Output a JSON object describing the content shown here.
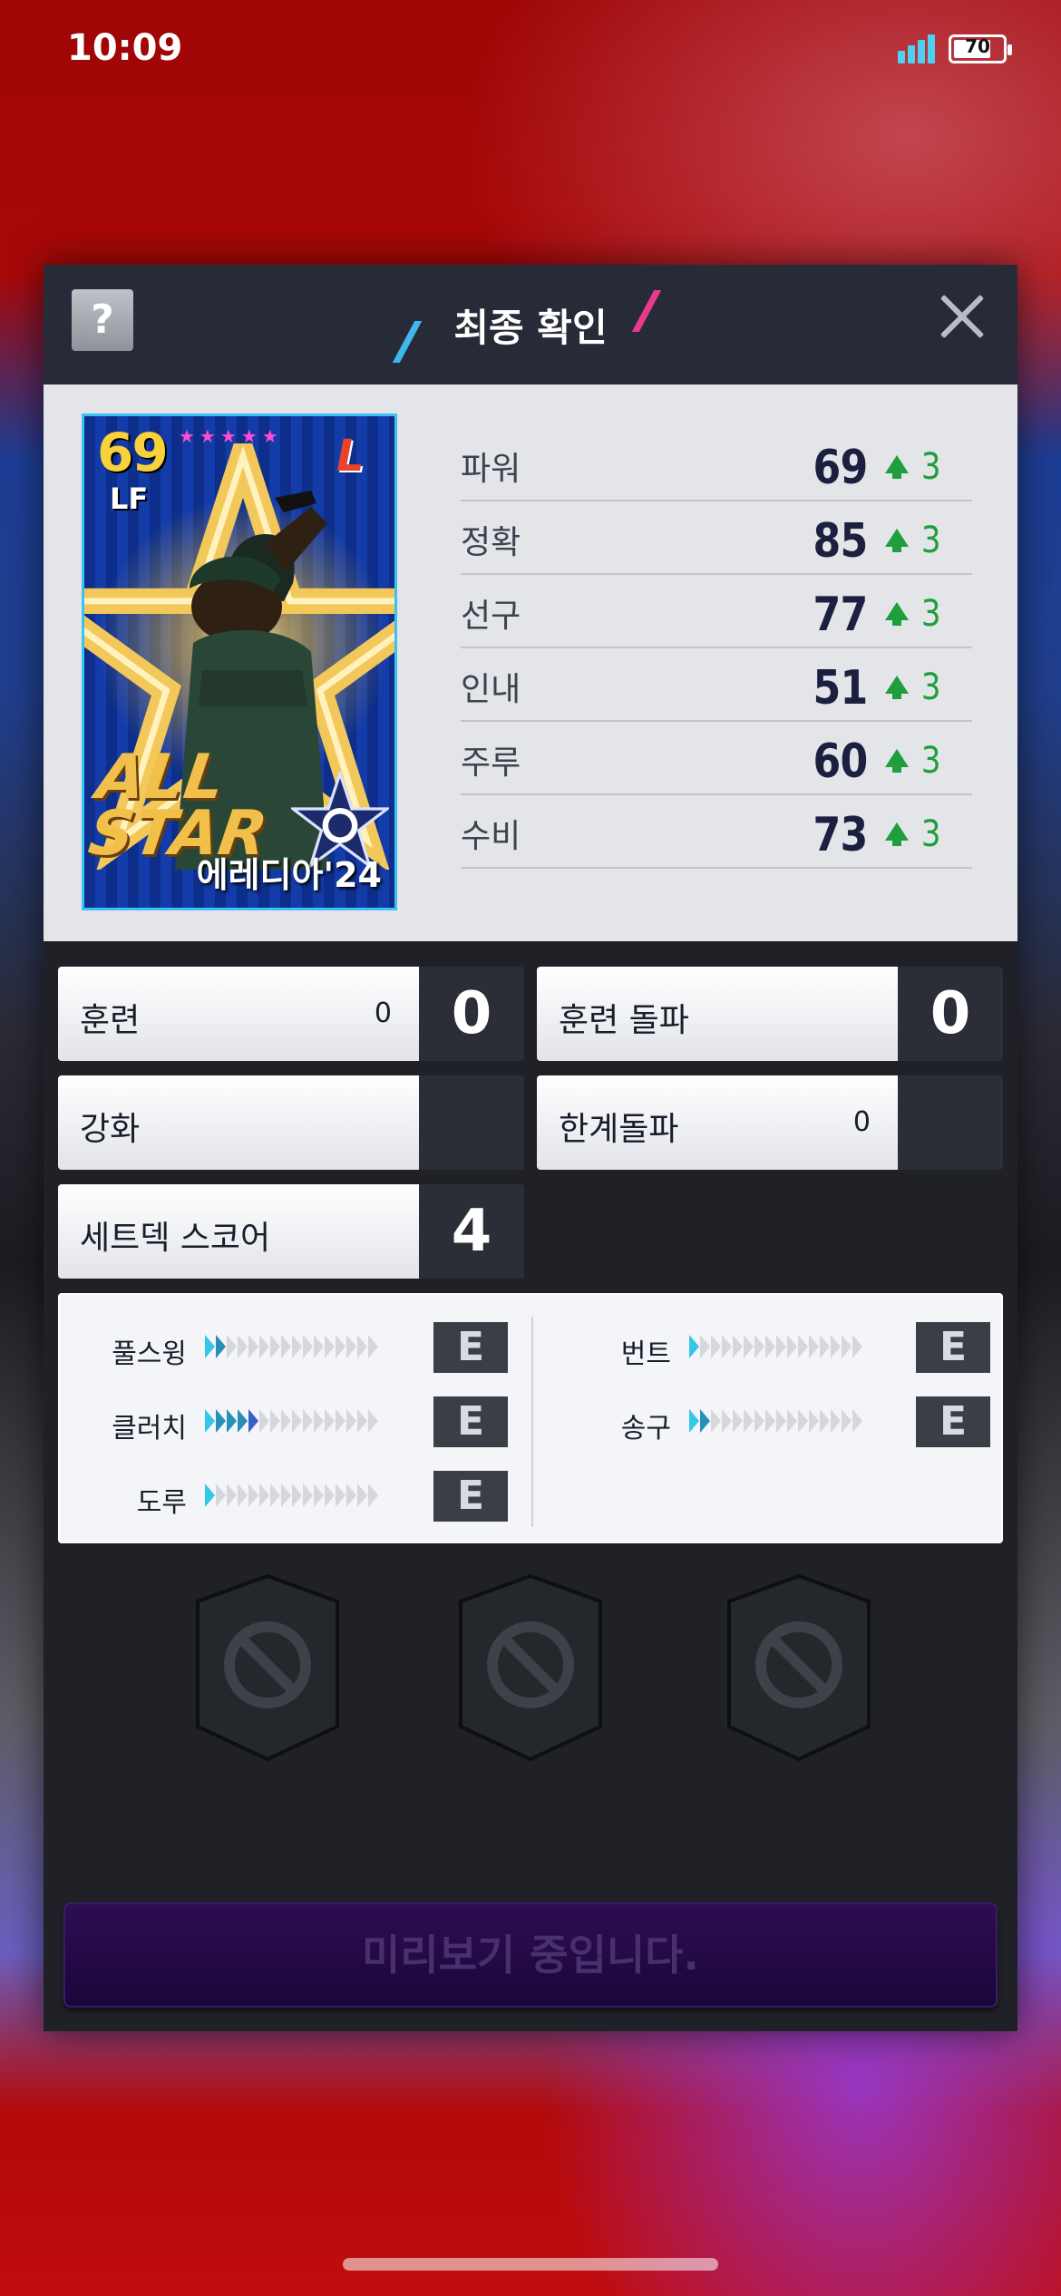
{
  "status_bar": {
    "time": "10:09",
    "battery_level": "70",
    "icons": [
      "signal-icon",
      "battery-icon"
    ]
  },
  "dialog": {
    "title": "최종 확인",
    "help_label": "?",
    "close_icon": "close-icon"
  },
  "card": {
    "overall": "69",
    "position": "LF",
    "grade_stars": "★★★★★",
    "team_logo": "L",
    "edition": "ALL STAR",
    "player_name": "에레디아'24"
  },
  "stats": [
    {
      "label": "파워",
      "value": "69",
      "increase": "3"
    },
    {
      "label": "정확",
      "value": "85",
      "increase": "3"
    },
    {
      "label": "선구",
      "value": "77",
      "increase": "3"
    },
    {
      "label": "인내",
      "value": "51",
      "increase": "3"
    },
    {
      "label": "주루",
      "value": "60",
      "increase": "3"
    },
    {
      "label": "수비",
      "value": "73",
      "increase": "3"
    }
  ],
  "upgrades": {
    "training": {
      "label": "훈련",
      "count": "0",
      "value": "0"
    },
    "training_breakthrough": {
      "label": "훈련 돌파",
      "value": "0"
    },
    "enhance": {
      "label": "강화",
      "value": ""
    },
    "limit_break": {
      "label": "한계돌파",
      "count": "0",
      "value": ""
    },
    "set_deck_score": {
      "label": "세트덱 스코어",
      "value": "4"
    }
  },
  "skills": [
    {
      "name": "풀스윙",
      "level": 2,
      "grade": "E"
    },
    {
      "name": "클러치",
      "level": 5,
      "grade": "E"
    },
    {
      "name": "도루",
      "level": 1,
      "grade": "E"
    },
    {
      "name": "번트",
      "level": 1,
      "grade": "E"
    },
    {
      "name": "송구",
      "level": 2,
      "grade": "E"
    }
  ],
  "slots": [
    "empty",
    "empty",
    "empty"
  ],
  "colors": {
    "accent_blue": "#3fb7ee",
    "accent_pink": "#e83a8e",
    "stat_up_green": "#1e9e3c",
    "confirm_bg": "#1a0639"
  },
  "confirm_button": {
    "label": "미리보기 중입니다."
  }
}
